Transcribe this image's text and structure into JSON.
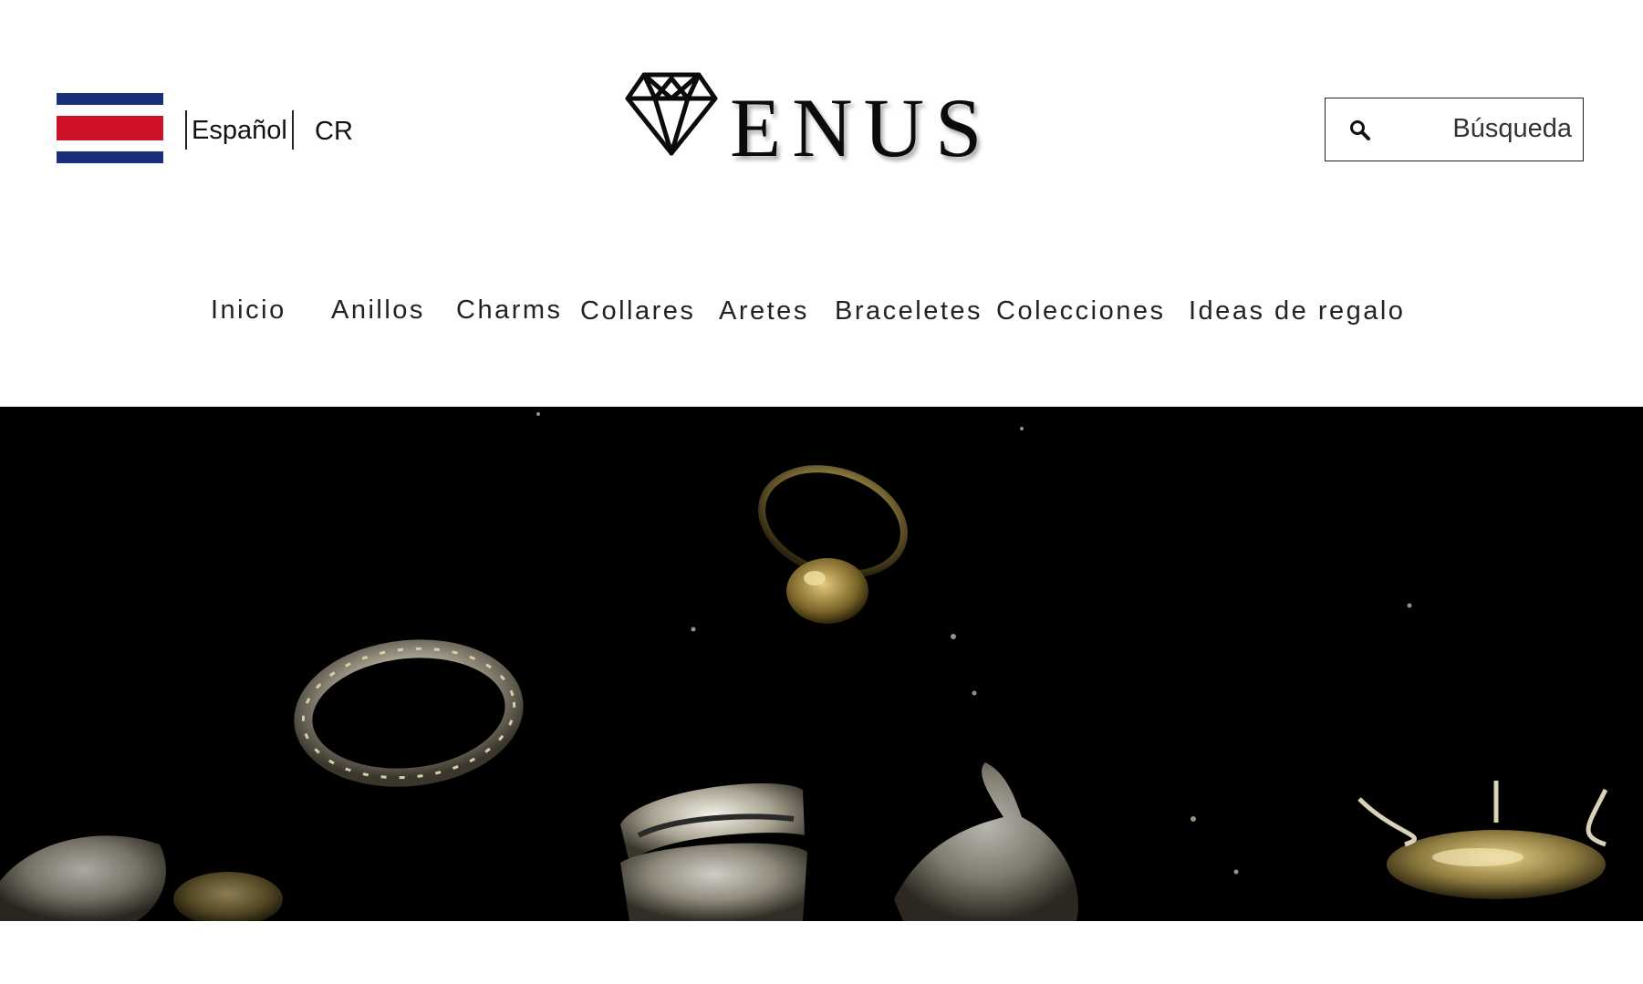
{
  "header": {
    "language": "Español",
    "country": "CR",
    "brand": "ENUS",
    "search": {
      "placeholder": "Búsqueda",
      "icon": "search-icon"
    },
    "flag": {
      "icon": "costa-rica-flag-icon",
      "colors": [
        "#1a2f7a",
        "#ffffff",
        "#ce1126"
      ]
    }
  },
  "nav": {
    "items": [
      {
        "label": "Inicio"
      },
      {
        "label": "Anillos"
      },
      {
        "label": "Charms"
      },
      {
        "label": "Collares"
      },
      {
        "label": "Aretes"
      },
      {
        "label": "Braceletes"
      },
      {
        "label": "Colecciones"
      },
      {
        "label": "Ideas de regalo"
      }
    ]
  },
  "hero": {
    "image": "jewelry-rings-on-black-background",
    "background_color": "#000000"
  }
}
